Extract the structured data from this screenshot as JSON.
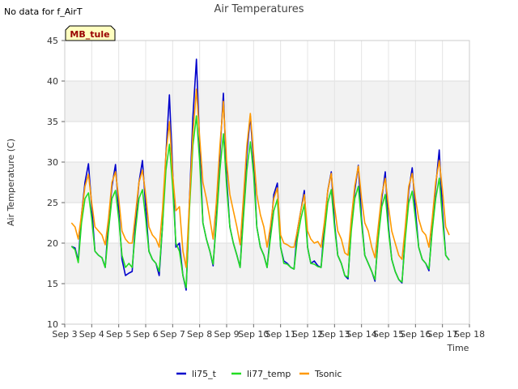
{
  "chart_data": {
    "type": "line",
    "title": "Air Temperatures",
    "note": "No data for f_AirT",
    "site_badge": "MB_tule",
    "xlabel": "Time",
    "ylabel": "Air Temperature (C)",
    "ylim": [
      10,
      45
    ],
    "yticks": [
      10,
      15,
      20,
      25,
      30,
      35,
      40,
      45
    ],
    "xlim": [
      3,
      18
    ],
    "xticks": [
      3,
      4,
      5,
      6,
      7,
      8,
      9,
      10,
      11,
      12,
      13,
      14,
      15,
      16,
      17,
      18
    ],
    "xtick_labels": [
      "Sep 3",
      "Sep 4",
      "Sep 5",
      "Sep 6",
      "Sep 7",
      "Sep 8",
      "Sep 9",
      "Sep 10",
      "Sep 11",
      "Sep 12",
      "Sep 13",
      "Sep 14",
      "Sep 15",
      "Sep 16",
      "Sep 17",
      "Sep 18"
    ],
    "grid": true,
    "legend_position": "bottom",
    "x_units": "day of September",
    "series": [
      {
        "name": "li75_t",
        "color": "#0000cc",
        "x": [
          3.25,
          3.38,
          3.5,
          3.62,
          3.75,
          3.88,
          4.0,
          4.12,
          4.25,
          4.38,
          4.5,
          4.62,
          4.75,
          4.88,
          5.0,
          5.12,
          5.25,
          5.38,
          5.5,
          5.62,
          5.75,
          5.88,
          6.0,
          6.12,
          6.25,
          6.38,
          6.5,
          6.62,
          6.75,
          6.88,
          7.0,
          7.12,
          7.25,
          7.38,
          7.5,
          7.62,
          7.75,
          7.88,
          8.0,
          8.12,
          8.25,
          8.38,
          8.5,
          8.62,
          8.75,
          8.88,
          9.0,
          9.12,
          9.25,
          9.38,
          9.5,
          9.62,
          9.75,
          9.88,
          10.0,
          10.12,
          10.25,
          10.38,
          10.5,
          10.62,
          10.75,
          10.88,
          11.0,
          11.12,
          11.25,
          11.38,
          11.5,
          11.62,
          11.75,
          11.88,
          12.0,
          12.12,
          12.25,
          12.38,
          12.5,
          12.62,
          12.75,
          12.88,
          13.0,
          13.12,
          13.25,
          13.38,
          13.5,
          13.62,
          13.75,
          13.88,
          14.0,
          14.12,
          14.25,
          14.38,
          14.5,
          14.62,
          14.75,
          14.88,
          15.0,
          15.12,
          15.25,
          15.38,
          15.5,
          15.62,
          15.75,
          15.88,
          16.0,
          16.12,
          16.25,
          16.38,
          16.5,
          16.62,
          16.75,
          16.88,
          17.0,
          17.12,
          17.25
        ],
        "values": [
          19.6,
          19.4,
          17.8,
          23.5,
          27.5,
          29.8,
          24.5,
          19.0,
          18.5,
          18.2,
          17.0,
          22.5,
          27.0,
          29.7,
          24.0,
          18.0,
          16.0,
          16.3,
          16.5,
          22.5,
          27.5,
          30.2,
          24.5,
          19.0,
          18.0,
          17.5,
          16.0,
          22.0,
          31.0,
          38.3,
          29.0,
          19.5,
          20.0,
          16.0,
          14.2,
          25.0,
          35.5,
          42.7,
          32.0,
          22.5,
          20.5,
          19.0,
          17.2,
          23.0,
          31.0,
          38.5,
          28.0,
          22.0,
          20.0,
          18.5,
          17.0,
          24.0,
          31.0,
          35.7,
          30.0,
          22.0,
          19.5,
          18.5,
          17.0,
          21.0,
          26.0,
          27.4,
          19.5,
          17.8,
          17.5,
          17.0,
          16.8,
          21.5,
          24.0,
          26.5,
          19.5,
          17.5,
          17.8,
          17.2,
          17.0,
          22.0,
          26.5,
          28.8,
          22.5,
          18.5,
          17.5,
          16.0,
          15.6,
          22.0,
          26.5,
          29.6,
          23.0,
          18.5,
          17.5,
          16.5,
          15.3,
          21.0,
          25.5,
          28.8,
          22.0,
          18.0,
          16.5,
          15.5,
          15.1,
          21.0,
          26.5,
          29.3,
          24.0,
          19.5,
          18.0,
          17.5,
          16.6,
          22.0,
          27.0,
          31.5,
          24.0,
          18.5,
          17.9
        ]
      },
      {
        "name": "li77_temp",
        "color": "#22dd22",
        "x": [
          3.25,
          3.38,
          3.5,
          3.62,
          3.75,
          3.88,
          4.0,
          4.12,
          4.25,
          4.38,
          4.5,
          4.62,
          4.75,
          4.88,
          5.0,
          5.12,
          5.25,
          5.38,
          5.5,
          5.62,
          5.75,
          5.88,
          6.0,
          6.12,
          6.25,
          6.38,
          6.5,
          6.62,
          6.75,
          6.88,
          7.0,
          7.12,
          7.25,
          7.38,
          7.5,
          7.62,
          7.75,
          7.88,
          8.0,
          8.12,
          8.25,
          8.38,
          8.5,
          8.62,
          8.75,
          8.88,
          9.0,
          9.12,
          9.25,
          9.38,
          9.5,
          9.62,
          9.75,
          9.88,
          10.0,
          10.12,
          10.25,
          10.38,
          10.5,
          10.62,
          10.75,
          10.88,
          11.0,
          11.12,
          11.25,
          11.38,
          11.5,
          11.62,
          11.75,
          11.88,
          12.0,
          12.12,
          12.25,
          12.38,
          12.5,
          12.62,
          12.75,
          12.88,
          13.0,
          13.12,
          13.25,
          13.38,
          13.5,
          13.62,
          13.75,
          13.88,
          14.0,
          14.12,
          14.25,
          14.38,
          14.5,
          14.62,
          14.75,
          14.88,
          15.0,
          15.12,
          15.25,
          15.38,
          15.5,
          15.62,
          15.75,
          15.88,
          16.0,
          16.12,
          16.25,
          16.38,
          16.5,
          16.62,
          16.75,
          16.88,
          17.0,
          17.12,
          17.25
        ],
        "values": [
          19.6,
          19.2,
          17.6,
          22.5,
          25.5,
          26.2,
          23.0,
          19.0,
          18.5,
          18.2,
          17.0,
          21.5,
          25.5,
          26.5,
          23.0,
          18.5,
          17.0,
          17.5,
          17.0,
          21.5,
          25.5,
          26.6,
          23.0,
          19.0,
          18.0,
          17.5,
          16.5,
          22.0,
          29.0,
          32.2,
          27.0,
          20.0,
          19.0,
          16.0,
          14.5,
          24.0,
          32.0,
          35.7,
          30.0,
          22.5,
          20.5,
          19.0,
          17.4,
          22.5,
          29.0,
          33.5,
          27.0,
          22.0,
          20.0,
          18.5,
          17.0,
          23.0,
          29.0,
          32.5,
          28.5,
          22.0,
          19.5,
          18.5,
          17.0,
          20.5,
          24.0,
          25.4,
          19.5,
          17.5,
          17.4,
          17.0,
          16.8,
          20.5,
          23.0,
          24.8,
          19.5,
          17.5,
          17.4,
          17.1,
          17.0,
          21.0,
          25.0,
          26.6,
          22.0,
          18.5,
          17.5,
          16.0,
          15.8,
          21.5,
          25.5,
          27.0,
          22.5,
          18.5,
          17.5,
          16.5,
          15.5,
          20.5,
          24.5,
          26.0,
          21.5,
          18.0,
          16.5,
          15.5,
          15.2,
          20.5,
          25.0,
          26.4,
          23.0,
          19.5,
          18.0,
          17.5,
          16.8,
          21.5,
          25.5,
          28.0,
          23.0,
          18.5,
          17.9
        ]
      },
      {
        "name": "Tsonic",
        "color": "#ff9900",
        "x": [
          3.25,
          3.38,
          3.5,
          3.62,
          3.75,
          3.88,
          4.0,
          4.12,
          4.25,
          4.38,
          4.5,
          4.62,
          4.75,
          4.88,
          5.0,
          5.12,
          5.25,
          5.38,
          5.5,
          5.62,
          5.75,
          5.88,
          6.0,
          6.12,
          6.25,
          6.38,
          6.5,
          6.62,
          6.75,
          6.88,
          7.0,
          7.12,
          7.25,
          7.38,
          7.5,
          7.62,
          7.75,
          7.88,
          8.0,
          8.12,
          8.25,
          8.38,
          8.5,
          8.62,
          8.75,
          8.88,
          9.0,
          9.12,
          9.25,
          9.38,
          9.5,
          9.62,
          9.75,
          9.88,
          10.0,
          10.12,
          10.25,
          10.38,
          10.5,
          10.62,
          10.75,
          10.88,
          11.0,
          11.12,
          11.25,
          11.38,
          11.5,
          11.62,
          11.75,
          11.88,
          12.0,
          12.12,
          12.25,
          12.38,
          12.5,
          12.62,
          12.75,
          12.88,
          13.0,
          13.12,
          13.25,
          13.38,
          13.5,
          13.62,
          13.75,
          13.88,
          14.0,
          14.12,
          14.25,
          14.38,
          14.5,
          14.62,
          14.75,
          14.88,
          15.0,
          15.12,
          15.25,
          15.38,
          15.5,
          15.62,
          15.75,
          15.88,
          16.0,
          16.12,
          16.25,
          16.38,
          16.5,
          16.62,
          16.75,
          16.88,
          17.0,
          17.12,
          17.25
        ],
        "values": [
          22.5,
          22.0,
          20.5,
          23.5,
          27.0,
          28.5,
          25.0,
          22.0,
          21.5,
          21.0,
          19.8,
          23.0,
          27.5,
          28.8,
          25.5,
          21.5,
          20.5,
          20.0,
          20.0,
          23.5,
          27.5,
          29.0,
          26.0,
          22.0,
          21.0,
          20.5,
          19.5,
          24.0,
          31.0,
          35.0,
          28.5,
          24.0,
          24.5,
          19.0,
          17.0,
          25.0,
          33.5,
          39.0,
          33.0,
          27.5,
          25.5,
          23.0,
          20.5,
          25.0,
          32.0,
          37.5,
          30.0,
          26.0,
          24.0,
          22.0,
          19.8,
          25.5,
          32.0,
          36.0,
          31.0,
          26.0,
          23.5,
          22.0,
          19.5,
          22.0,
          25.5,
          26.8,
          21.0,
          20.0,
          19.8,
          19.5,
          19.5,
          21.5,
          24.0,
          26.0,
          21.5,
          20.5,
          20.0,
          20.2,
          19.5,
          22.5,
          26.5,
          28.6,
          24.5,
          21.5,
          20.5,
          18.8,
          18.5,
          23.0,
          27.0,
          29.5,
          25.5,
          22.5,
          21.5,
          19.5,
          18.2,
          22.0,
          26.0,
          28.0,
          24.5,
          21.5,
          20.0,
          18.5,
          18.0,
          22.0,
          27.0,
          28.6,
          25.5,
          23.0,
          21.5,
          21.0,
          19.5,
          23.0,
          27.5,
          30.2,
          26.5,
          22.0,
          21.0
        ]
      }
    ]
  }
}
